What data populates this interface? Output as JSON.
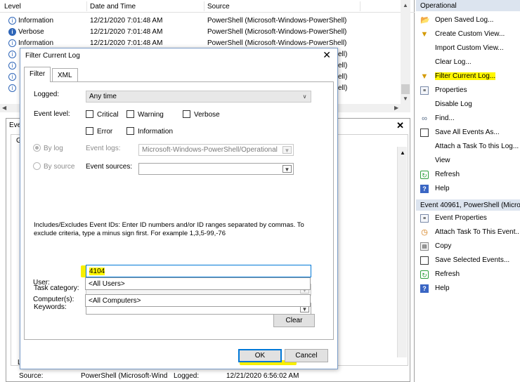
{
  "event_list": {
    "columns": [
      "Level",
      "Date and Time",
      "Source"
    ],
    "rows": [
      {
        "level": "Information",
        "date": "12/21/2020 7:01:48 AM",
        "source": "PowerShell (Microsoft-Windows-PowerShell)",
        "icon": "information-icon"
      },
      {
        "level": "Verbose",
        "date": "12/21/2020 7:01:48 AM",
        "source": "PowerShell (Microsoft-Windows-PowerShell)",
        "icon": "verbose-icon"
      },
      {
        "level": "Information",
        "date": "12/21/2020 7:01:48 AM",
        "source": "PowerShell (Microsoft-Windows-PowerShell)",
        "icon": "information-icon"
      }
    ],
    "truncated_sources": [
      "ell)",
      "ell)",
      "ell)",
      "ell)"
    ]
  },
  "detail_panel": {
    "title": "Eve",
    "tab_letter": "G",
    "l_label": "L",
    "source_label": "Source:",
    "source_value": "PowerShell (Microsoft-Wind",
    "logged_label": "Logged:",
    "logged_value": "12/21/2020 6:56:02 AM"
  },
  "actions": {
    "section1_header": "Operational",
    "section1_items": [
      {
        "label": "Open Saved Log...",
        "icon": "folder-open-icon"
      },
      {
        "label": "Create Custom View...",
        "icon": "filter-icon"
      },
      {
        "label": "Import Custom View...",
        "icon": ""
      },
      {
        "label": "Clear Log...",
        "icon": ""
      },
      {
        "label": "Filter Current Log...",
        "icon": "filter-icon"
      },
      {
        "label": "Properties",
        "icon": "properties-icon"
      },
      {
        "label": "Disable Log",
        "icon": ""
      },
      {
        "label": "Find...",
        "icon": "binoculars-icon"
      },
      {
        "label": "Save All Events As...",
        "icon": "save-icon"
      },
      {
        "label": "Attach a Task To this Log...",
        "icon": ""
      },
      {
        "label": "View",
        "icon": ""
      },
      {
        "label": "Refresh",
        "icon": "refresh-icon"
      },
      {
        "label": "Help",
        "icon": "help-icon"
      }
    ],
    "section2_header": "Event 40961, PowerShell (Micros",
    "section2_items": [
      {
        "label": "Event Properties",
        "icon": "properties-icon"
      },
      {
        "label": "Attach Task To This Event...",
        "icon": "task-icon"
      },
      {
        "label": "Copy",
        "icon": "copy-icon"
      },
      {
        "label": "Save Selected Events...",
        "icon": "save-icon"
      },
      {
        "label": "Refresh",
        "icon": "refresh-icon"
      },
      {
        "label": "Help",
        "icon": "help-icon"
      }
    ]
  },
  "dialog": {
    "title": "Filter Current Log",
    "tabs": [
      "Filter",
      "XML"
    ],
    "logged_label": "Logged:",
    "logged_value": "Any time",
    "event_level_label": "Event level:",
    "levels": [
      "Critical",
      "Warning",
      "Verbose",
      "Error",
      "Information"
    ],
    "by_log": "By log",
    "by_source": "By source",
    "event_logs_label": "Event logs:",
    "event_logs_value": "Microsoft-Windows-PowerShell/Operational",
    "event_sources_label": "Event sources:",
    "description": "Includes/Excludes Event IDs: Enter ID numbers and/or ID ranges separated by commas. To exclude criteria, type a minus sign first. For example 1,3,5-99,-76",
    "event_id_value": "4104",
    "task_category_label": "Task category:",
    "keywords_label": "Keywords:",
    "user_label": "User:",
    "user_value": "<All Users>",
    "computer_label": "Computer(s):",
    "computer_value": "<All Computers>",
    "clear_label": "Clear",
    "ok_label": "OK",
    "cancel_label": "Cancel"
  },
  "colors": {
    "highlight": "#fff700",
    "accent": "#0078d7",
    "actions_header": "#dce4ef"
  }
}
